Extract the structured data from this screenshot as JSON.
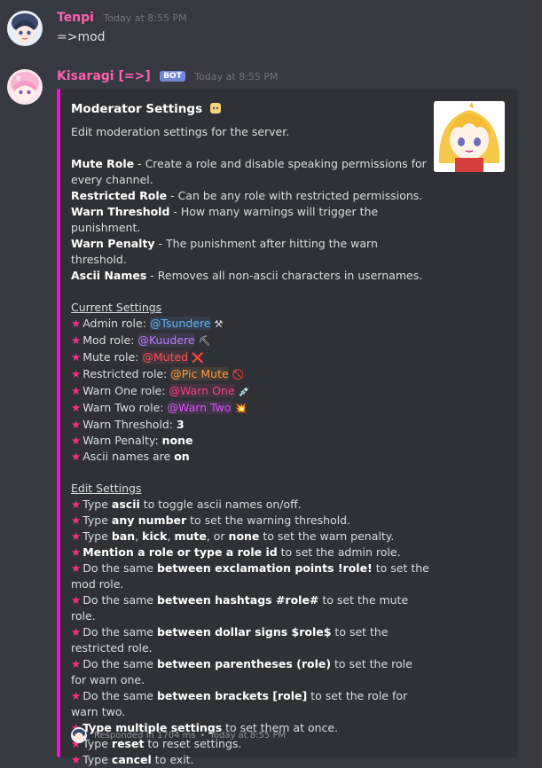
{
  "messages": [
    {
      "username": "Tenpi",
      "timestamp": "Today at 8:55 PM",
      "text": "=>mod"
    },
    {
      "username": "Kisaragi [=>]",
      "badge": "BOT",
      "timestamp": "Today at 8:55 PM"
    }
  ],
  "colors": {
    "tenpi": "#ff5fb1",
    "kisaragi": "#ff5fb1",
    "embed_border": "#ff0ad0",
    "star": "#ff2a86"
  },
  "embed": {
    "title": "Moderator Settings",
    "description": "Edit moderation settings for the server.",
    "definitions": [
      {
        "term": "Mute Role",
        "desc": " - Create a role and disable speaking permissions for every channel."
      },
      {
        "term": "Restricted Role",
        "desc": " - Can be any role with restricted permissions."
      },
      {
        "term": "Warn Threshold",
        "desc": " - How many warnings will trigger the punishment."
      },
      {
        "term": "Warn Penalty",
        "desc": " - The punishment after hitting the warn threshold."
      },
      {
        "term": "Ascii Names",
        "desc": " - Removes all non-ascii characters in usernames."
      }
    ],
    "current_heading": "Current Settings",
    "current": [
      {
        "label": "Admin role: ",
        "mention": "@Tsundere",
        "emoji": "⚒"
      },
      {
        "label": "Mod role: ",
        "mention": "@Kuudere",
        "emoji": "⛏"
      },
      {
        "label": "Mute role: ",
        "mention": "@Muted",
        "emoji": "❌"
      },
      {
        "label": "Restricted role: ",
        "mention": "@Pic Mute",
        "emoji": "🚫"
      },
      {
        "label": "Warn One role: ",
        "mention": "@Warn One",
        "emoji": "💉"
      },
      {
        "label": "Warn Two role: ",
        "mention": "@Warn Two",
        "emoji": "💥"
      },
      {
        "label": "Warn Threshold: ",
        "value": "3"
      },
      {
        "label": "Warn Penalty: ",
        "value": "none"
      },
      {
        "label": "Ascii names are ",
        "value": "on"
      }
    ],
    "edit_heading": "Edit Settings",
    "edit": [
      {
        "pre": "Type ",
        "bold": "ascii",
        "post": " to toggle ascii names on/off."
      },
      {
        "pre": "Type ",
        "bold": "any number",
        "post": " to set the warning threshold."
      },
      {
        "pre": "Type ",
        "bold": "ban",
        "post": ", "
      },
      {
        "pre": "",
        "bold": "Mention a role or type a role id",
        "post": " to set the admin role."
      },
      {
        "pre": "Do the same ",
        "bold": "between exclamation points !role!",
        "post": " to set the mod role."
      },
      {
        "pre": "Do the same ",
        "bold": "between hashtags #role#",
        "post": " to set the mute role."
      },
      {
        "pre": "Do the same ",
        "bold": "between dollar signs $role$",
        "post": " to set the restricted role."
      },
      {
        "pre": "Do the same ",
        "bold": "between parentheses (role)",
        "post": " to set the role for warn one."
      },
      {
        "pre": "Do the same ",
        "bold": "between brackets [role]",
        "post": " to set the role for warn two."
      },
      {
        "pre": "",
        "bold": "Type multiple settings",
        "post": " to set them at once."
      },
      {
        "pre": "Type ",
        "bold": "reset",
        "post": " to reset settings."
      },
      {
        "pre": "Type ",
        "bold": "cancel",
        "post": " to exit."
      }
    ],
    "penalty_line": {
      "b1": "kick",
      "s1": ", ",
      "b2": "mute",
      "s2": ", or ",
      "b3": "none",
      "post": " to set the warn penalty."
    },
    "footer": {
      "responded": "Responded in 1704 ms",
      "separator": "•",
      "timestamp": "Today at 8:55 PM"
    }
  }
}
